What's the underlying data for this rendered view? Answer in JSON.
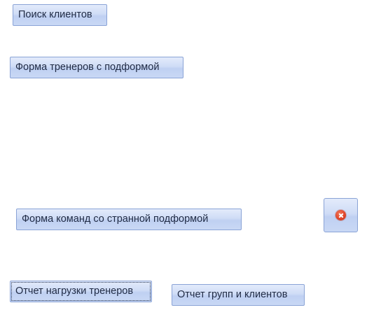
{
  "form": {
    "buttons": {
      "client_search": "Поиск клиентов",
      "trainers_form": "Форма тренеров с подформой",
      "teams_form": "Форма команд со странной подформой",
      "trainers_load_report": "Отчет нагрузки тренеров",
      "groups_clients_report": "Отчет групп и клиентов",
      "close_icon": "close-icon"
    },
    "colors": {
      "button_border": "#8aa3d6",
      "button_fill": "#cfdcf6",
      "button_text": "#1f2a44",
      "close_icon": "#e0462a"
    }
  }
}
